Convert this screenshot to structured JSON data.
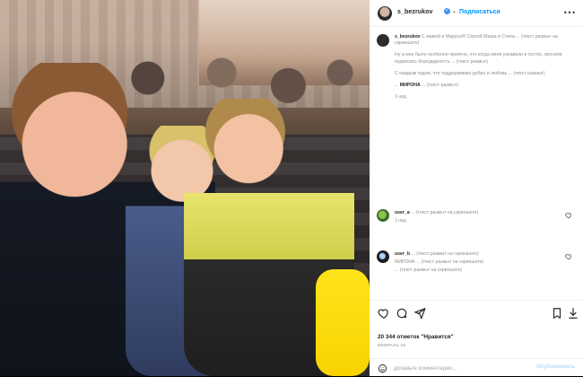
{
  "header": {
    "username": "s_bezrukov",
    "verified_icon": "verified-badge-icon",
    "separator": "•",
    "follow_label": "Подписаться",
    "more_label": "⋯"
  },
  "comments": [
    {
      "username": "s_bezrukov",
      "text_line": "С мамой и Марусей! Сергей Маша и Степа ... (текст размыт на скриншоте)",
      "time": ""
    },
    {
      "username": "",
      "text_line": "... (текст размыт на скриншоте)",
      "time": ""
    },
    {
      "username": "",
      "text_line": "... (текст размыт на скриншоте)",
      "time": ""
    },
    {
      "username": "",
      "text_line": "... (текст размыт на скриншоте)",
      "time": ""
    },
    {
      "username": "",
      "text_line": "МИРОНА ... (текст размыт на скриншоте)",
      "time": ""
    },
    {
      "username": "",
      "text_line": "... (текст размыт на скриншоте)",
      "time": ""
    }
  ],
  "actions": {
    "likes_text": "20 344 отметок \"Нравится\"",
    "date_text": "ФЕВРАЛЬ 26"
  },
  "add_comment": {
    "placeholder": "Добавьте комментарий...",
    "post_label": "Опубликовать"
  },
  "icons": {
    "heart": "heart-icon",
    "comment": "comment-icon",
    "share": "share-icon",
    "save": "bookmark-icon",
    "download": "download-icon",
    "smile": "emoji-icon"
  }
}
